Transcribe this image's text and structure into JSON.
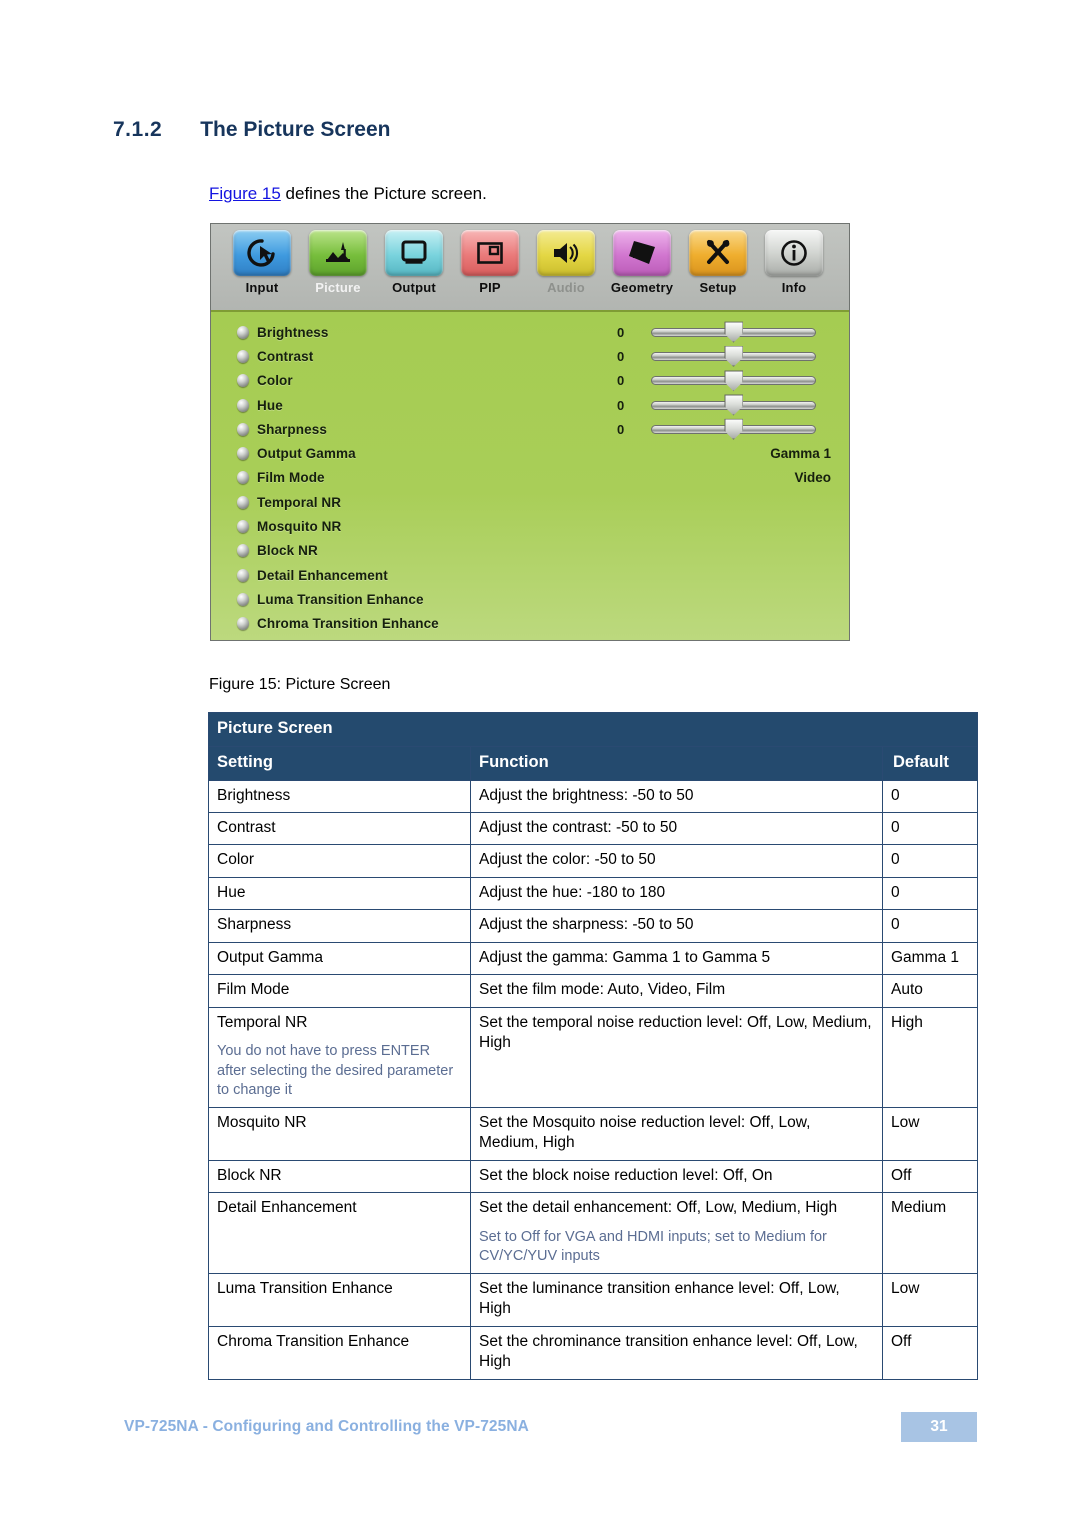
{
  "heading": {
    "number": "7.1.2",
    "title": "The Picture Screen"
  },
  "intro": {
    "link": "Figure 15",
    "rest": " defines the Picture screen."
  },
  "figure": {
    "caption": "Figure 15: Picture Screen",
    "osd": {
      "tabs": [
        {
          "label": "Input",
          "icon": "input-cursor-icon",
          "color": "#4aa3e0",
          "state": "normal"
        },
        {
          "label": "Picture",
          "icon": "picture-scene-icon",
          "color": "#7ec242",
          "state": "active"
        },
        {
          "label": "Output",
          "icon": "output-monitor-icon",
          "color": "#7fd8e0",
          "state": "normal"
        },
        {
          "label": "PIP",
          "icon": "pip-frames-icon",
          "color": "#ec8080",
          "state": "normal"
        },
        {
          "label": "Audio",
          "icon": "audio-speaker-icon",
          "color": "#e8dd56",
          "state": "disabled"
        },
        {
          "label": "Geometry",
          "icon": "geometry-shapes-icon",
          "color": "#d98ad8",
          "state": "normal"
        },
        {
          "label": "Setup",
          "icon": "setup-tools-icon",
          "color": "#f0b63c",
          "state": "normal"
        },
        {
          "label": "Info",
          "icon": "info-circle-icon",
          "color": "#cfd2cf",
          "state": "normal"
        }
      ],
      "rows": [
        {
          "label": "Brightness",
          "value": "0",
          "slider": true
        },
        {
          "label": "Contrast",
          "value": "0",
          "slider": true
        },
        {
          "label": "Color",
          "value": "0",
          "slider": true
        },
        {
          "label": "Hue",
          "value": "0",
          "slider": true
        },
        {
          "label": "Sharpness",
          "value": "0",
          "slider": true
        },
        {
          "label": "Output Gamma",
          "value": "Gamma 1",
          "slider": false
        },
        {
          "label": "Film Mode",
          "value": "Video",
          "slider": false
        },
        {
          "label": "Temporal NR",
          "value": "",
          "slider": false
        },
        {
          "label": "Mosquito NR",
          "value": "",
          "slider": false
        },
        {
          "label": "Block NR",
          "value": "",
          "slider": false
        },
        {
          "label": "Detail Enhancement",
          "value": "",
          "slider": false
        },
        {
          "label": "Luma Transition Enhance",
          "value": "",
          "slider": false
        },
        {
          "label": "Chroma Transition Enhance",
          "value": "",
          "slider": false
        }
      ]
    }
  },
  "table": {
    "title": "Picture Screen",
    "columns": [
      "Setting",
      "Function",
      "Default"
    ],
    "rows": [
      {
        "setting": "Brightness",
        "note": "",
        "function": "Adjust the brightness: -50 to 50",
        "function_note": "",
        "default": "0"
      },
      {
        "setting": "Contrast",
        "note": "",
        "function": "Adjust the contrast: -50 to 50",
        "function_note": "",
        "default": "0"
      },
      {
        "setting": "Color",
        "note": "",
        "function": "Adjust the color: -50 to 50",
        "function_note": "",
        "default": "0"
      },
      {
        "setting": "Hue",
        "note": "",
        "function": "Adjust the hue: -180 to 180",
        "function_note": "",
        "default": "0"
      },
      {
        "setting": "Sharpness",
        "note": "",
        "function": "Adjust the sharpness: -50 to 50",
        "function_note": "",
        "default": "0"
      },
      {
        "setting": "Output Gamma",
        "note": "",
        "function": "Adjust the gamma: Gamma 1 to Gamma 5",
        "function_note": "",
        "default": "Gamma 1"
      },
      {
        "setting": "Film Mode",
        "note": "",
        "function": "Set the film mode: Auto, Video, Film",
        "function_note": "",
        "default": "Auto"
      },
      {
        "setting": "Temporal NR",
        "note": "You do not have to press ENTER after selecting the desired parameter to change it",
        "function": "Set the temporal noise reduction level: Off, Low, Medium, High",
        "function_note": "",
        "default": "High"
      },
      {
        "setting": "Mosquito NR",
        "note": "",
        "function": "Set the Mosquito noise reduction level: Off, Low, Medium, High",
        "function_note": "",
        "default": "Low"
      },
      {
        "setting": "Block NR",
        "note": "",
        "function": "Set the block noise reduction level: Off, On",
        "function_note": "",
        "default": "Off"
      },
      {
        "setting": "Detail Enhancement",
        "note": "",
        "function": "Set the detail enhancement: Off, Low, Medium, High",
        "function_note": "Set to Off for VGA and HDMI inputs; set to Medium for CV/YC/YUV inputs",
        "default": "Medium"
      },
      {
        "setting": "Luma Transition Enhance",
        "note": "",
        "function": "Set the luminance transition enhance level: Off, Low, High",
        "function_note": "",
        "default": "Low"
      },
      {
        "setting": "Chroma Transition Enhance",
        "note": "",
        "function": "Set the chrominance transition enhance level: Off, Low, High",
        "function_note": "",
        "default": "Off"
      }
    ]
  },
  "footer": {
    "text": "VP-725NA - Configuring and Controlling the VP-725NA",
    "page": "31"
  }
}
